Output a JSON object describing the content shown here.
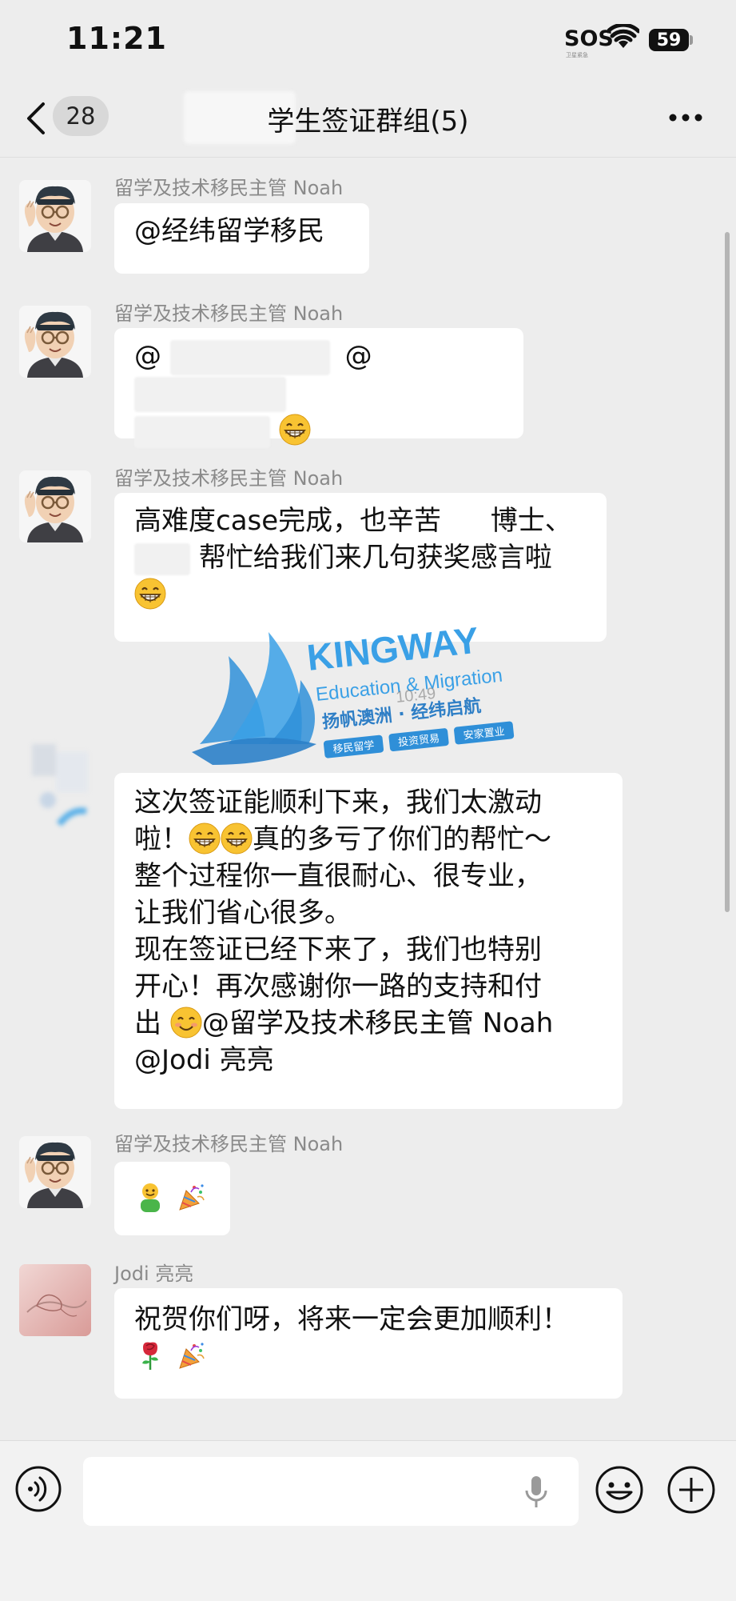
{
  "status_bar": {
    "time": "11:21",
    "sos": "SOS",
    "sos_sub": "卫星紧急",
    "battery": "59"
  },
  "nav": {
    "back_count": "28",
    "title": "学生签证群组(5)"
  },
  "messages": [
    {
      "sender": "留学及技术移民主管 Noah",
      "text": "@经纬留学移民"
    },
    {
      "sender": "留学及技术移民主管 Noah",
      "at1": "@",
      "at2": "@"
    },
    {
      "sender": "留学及技术移民主管 Noah",
      "line1": "高难度case完成，也辛苦",
      "line1b": "博士、",
      "line2": "帮忙给我们来几句获奖感言啦"
    },
    {
      "lines": [
        "这次签证能顺利下来，我们太激动",
        "啦！",
        "真的多亏了你们的帮忙～",
        "整个过程你一直很耐心、很专业，",
        "让我们省心很多。",
        "现在签证已经下来了，我们也特别",
        "开心！再次感谢你一路的支持和付",
        "出",
        "@留学及技术移民主管 Noah",
        "@Jodi 亮亮"
      ]
    },
    {
      "sender": "留学及技术移民主管 Noah"
    },
    {
      "sender": "Jodi 亮亮",
      "text": "祝贺你们呀，将来一定会更加顺利！"
    }
  ],
  "watermark": {
    "brand": "KINGWAY",
    "sub": "Education & Migration",
    "slogan": "扬帆澳洲 · 经纬启航",
    "time": "10:49",
    "tags": [
      "移民留学",
      "投资贸易",
      "安家置业"
    ]
  },
  "icons": {
    "back": "chevron-left-icon",
    "more": "more-dots-icon",
    "voice": "voice-icon",
    "mic": "microphone-icon",
    "emoji": "emoji-icon",
    "add": "plus-icon"
  },
  "colors": {
    "background": "#ededed",
    "bubble": "#ffffff",
    "watermark_blue": "#2f8fd8"
  }
}
